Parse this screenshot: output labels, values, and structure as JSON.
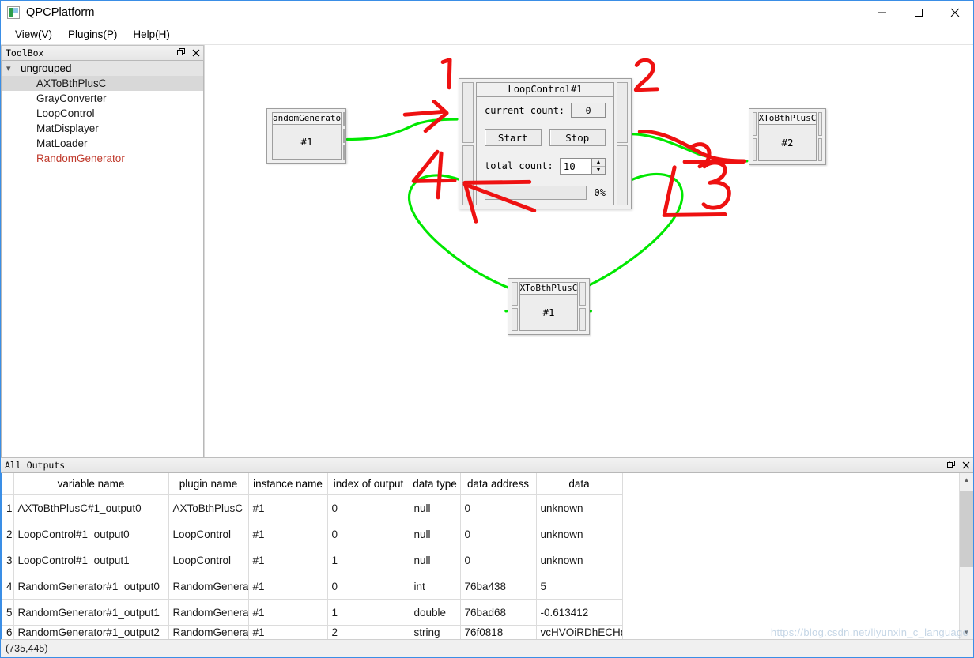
{
  "window": {
    "title": "QPCPlatform",
    "icon": "app-icon",
    "minimize_label": "Minimize",
    "maximize_label": "Maximize",
    "close_label": "Close"
  },
  "menubar": {
    "items": [
      {
        "label": "View",
        "mnemonic": "V"
      },
      {
        "label": "Plugins",
        "mnemonic": "P"
      },
      {
        "label": "Help",
        "mnemonic": "H"
      }
    ]
  },
  "toolbox": {
    "title": "ToolBox",
    "group": "ungrouped",
    "items": [
      {
        "label": "AXToBthPlusC",
        "selected": true
      },
      {
        "label": "GrayConverter",
        "selected": false
      },
      {
        "label": "LoopControl",
        "selected": false
      },
      {
        "label": "MatDisplayer",
        "selected": false
      },
      {
        "label": "MatLoader",
        "selected": false
      },
      {
        "label": "RandomGenerator",
        "selected": false
      }
    ]
  },
  "canvas": {
    "nodes": [
      {
        "id": "randomgenerator1",
        "title": "andomGenerato",
        "instance": "#1"
      },
      {
        "id": "axtobthplusc2",
        "title": "XToBthPlusC",
        "instance": "#2"
      },
      {
        "id": "axtobthplusc1",
        "title": "XToBthPlusC",
        "instance": "#1"
      }
    ],
    "loop_control": {
      "title": "LoopControl#1",
      "current_count_label": "current count:",
      "current_count_value": "0",
      "start_label": "Start",
      "stop_label": "Stop",
      "total_count_label": "total count:",
      "total_count_value": "10",
      "progress_percent": "0%"
    },
    "annotations": [
      {
        "label": "1"
      },
      {
        "label": "2"
      },
      {
        "label": "3"
      },
      {
        "label": "4"
      }
    ],
    "wire_color": "#00e800",
    "annotation_color": "#ee1111"
  },
  "outputs": {
    "title": "All Outputs",
    "columns": [
      "variable name",
      "plugin name",
      "instance name",
      "index of output",
      "data type",
      "data address",
      "data"
    ],
    "rows": [
      {
        "n": "1",
        "variable_name": "AXToBthPlusC#1_output0",
        "plugin_name": "AXToBthPlusC",
        "instance_name": "#1",
        "index_of_output": "0",
        "data_type": "null",
        "data_address": "0",
        "data": "unknown"
      },
      {
        "n": "2",
        "variable_name": "LoopControl#1_output0",
        "plugin_name": "LoopControl",
        "instance_name": "#1",
        "index_of_output": "0",
        "data_type": "null",
        "data_address": "0",
        "data": "unknown"
      },
      {
        "n": "3",
        "variable_name": "LoopControl#1_output1",
        "plugin_name": "LoopControl",
        "instance_name": "#1",
        "index_of_output": "1",
        "data_type": "null",
        "data_address": "0",
        "data": "unknown"
      },
      {
        "n": "4",
        "variable_name": "RandomGenerator#1_output0",
        "plugin_name": "RandomGenerator",
        "instance_name": "#1",
        "index_of_output": "0",
        "data_type": "int",
        "data_address": "76ba438",
        "data": "5"
      },
      {
        "n": "5",
        "variable_name": "RandomGenerator#1_output1",
        "plugin_name": "RandomGenerator",
        "instance_name": "#1",
        "index_of_output": "1",
        "data_type": "double",
        "data_address": "76bad68",
        "data": "-0.613412"
      },
      {
        "n": "6",
        "variable_name": "RandomGenerator#1_output2",
        "plugin_name": "RandomGenerator",
        "instance_name": "#1",
        "index_of_output": "2",
        "data_type": "string",
        "data_address": "76f0818",
        "data": "vcHVOiRDhECHdna"
      }
    ]
  },
  "statusbar": {
    "coordinates": "(735,445)"
  },
  "watermark": {
    "text": "https://blog.csdn.net/liyunxin_c_language"
  }
}
